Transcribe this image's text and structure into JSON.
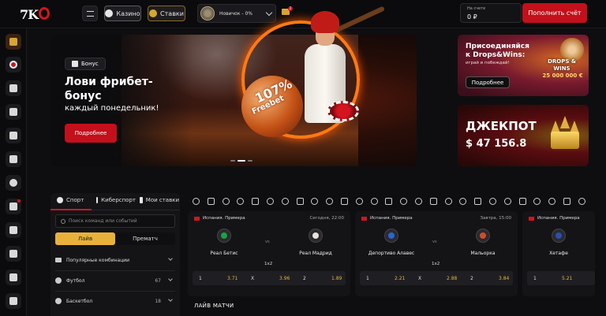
{
  "header": {
    "logo_text": "7K",
    "casino_label": "Казино",
    "bets_label": "Ставки",
    "profile_label": "Новичок - 0%",
    "mail_badge": "2",
    "balance_label": "На счете",
    "balance_value": "0 ₽",
    "deposit_label": "Пополнить счёт"
  },
  "banner": {
    "badge": "Бонус",
    "title": "Лови фрибет-бонус",
    "subtitle": "каждый понедельник!",
    "button": "Подробнее",
    "ball_line1": "107%",
    "ball_line2": "Freebet"
  },
  "promos": {
    "drops_title": "Присоединяйся к Drops&Wins:",
    "drops_sub": "играй и побеждай!",
    "drops_button": "Подробнее",
    "drops_logo": "DROPS & WINS",
    "drops_amount": "25 000 000 €",
    "jackpot_title": "ДЖЕКПОТ",
    "jackpot_amount": "$ 47 156.8"
  },
  "sports_panel": {
    "tabs": [
      "Спорт",
      "Киберспорт",
      "Мои ставки"
    ],
    "search_placeholder": "Поиск команд или событий",
    "live_label": "Лайв",
    "prematch_label": "Прематч",
    "rows": [
      {
        "label": "Популярные комбинации",
        "count": ""
      },
      {
        "label": "Футбол",
        "count": "67"
      },
      {
        "label": "Баскетбол",
        "count": "18"
      }
    ]
  },
  "matches": [
    {
      "league": "Испания. Примера",
      "time": "Сегодня, 22:00",
      "home": "Реал Бетис",
      "away": "Реал Мадрид",
      "home_color": "#1e9e46",
      "away_color": "#e9e4d8",
      "type": "1x2",
      "odds": [
        {
          "k": "1",
          "v": "3.71"
        },
        {
          "k": "X",
          "v": "3.96"
        },
        {
          "k": "2",
          "v": "1.89"
        }
      ]
    },
    {
      "league": "Испания. Примера",
      "time": "Завтра, 15:00",
      "home": "Депортиво Алавес",
      "away": "Мальорка",
      "home_color": "#2a63d4",
      "away_color": "#d6482a",
      "type": "1x2",
      "odds": [
        {
          "k": "1",
          "v": "2.21"
        },
        {
          "k": "X",
          "v": "2.88"
        },
        {
          "k": "2",
          "v": "3.84"
        }
      ]
    },
    {
      "league": "Испания. Примера",
      "time": "",
      "home": "Хетафе",
      "away": "",
      "home_color": "#2a4fb0",
      "away_color": "",
      "type": "",
      "odds": [
        {
          "k": "1",
          "v": "5.21"
        }
      ]
    }
  ],
  "live_section_title": "ЛАЙВ МАТЧИ",
  "colors": {
    "accent_red": "#c3101a",
    "accent_gold": "#e8b23a",
    "bg": "#0e0e10"
  }
}
